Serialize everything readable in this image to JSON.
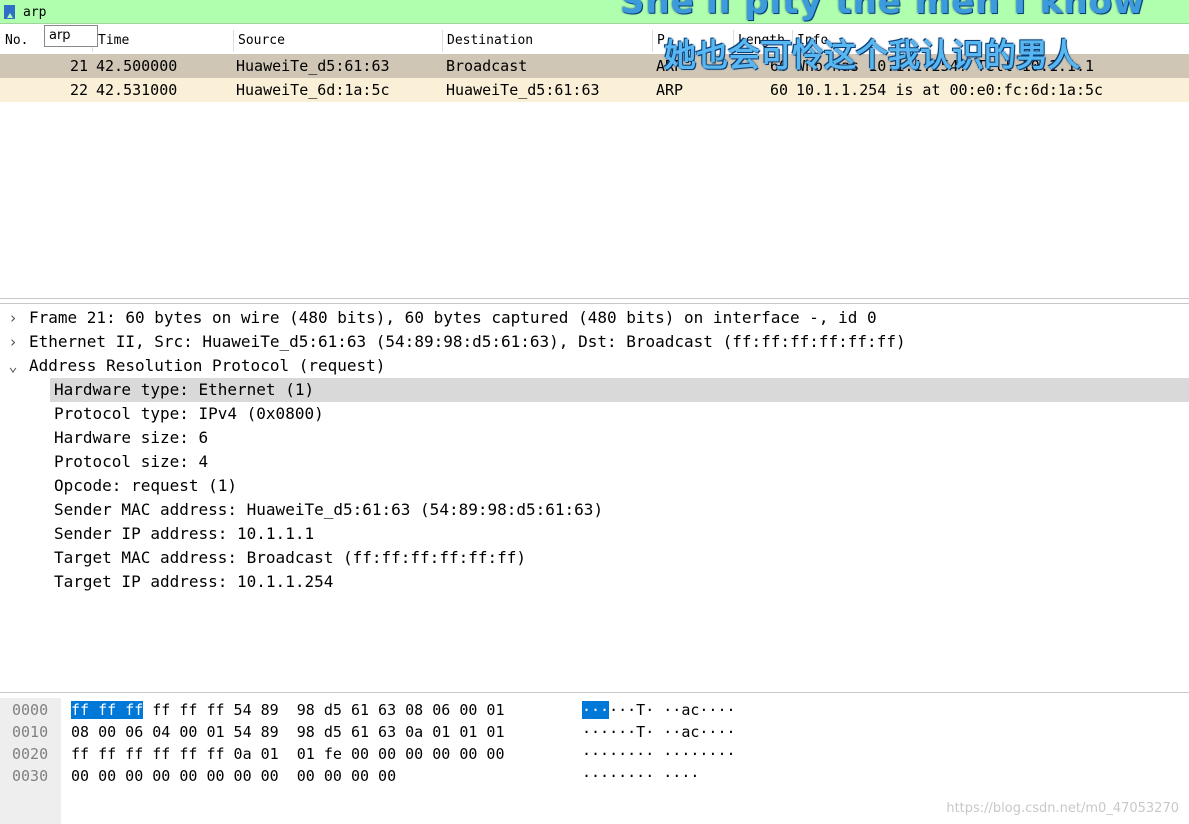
{
  "filter": {
    "value": "arp",
    "suggestion": "arp"
  },
  "packet_list": {
    "columns": [
      "No.",
      "Time",
      "Source",
      "Destination",
      "P",
      "Length",
      "Info"
    ],
    "rows": [
      {
        "no": "21",
        "time": "42.500000",
        "source": "HuaweiTe_d5:61:63",
        "destination": "Broadcast",
        "protocol": "ARP",
        "length": "60",
        "info": "Who has 10.1.1.254? Tell 10.1.1.1"
      },
      {
        "no": "22",
        "time": "42.531000",
        "source": "HuaweiTe_6d:1a:5c",
        "destination": "HuaweiTe_d5:61:63",
        "protocol": "ARP",
        "length": "60",
        "info": "10.1.1.254 is at 00:e0:fc:6d:1a:5c"
      }
    ]
  },
  "details": {
    "frame": "Frame 21: 60 bytes on wire (480 bits), 60 bytes captured (480 bits) on interface -, id 0",
    "ethernet": "Ethernet II, Src: HuaweiTe_d5:61:63 (54:89:98:d5:61:63), Dst: Broadcast (ff:ff:ff:ff:ff:ff)",
    "arp": "Address Resolution Protocol (request)",
    "arp_fields": [
      "Hardware type: Ethernet (1)",
      "Protocol type: IPv4 (0x0800)",
      "Hardware size: 6",
      "Protocol size: 4",
      "Opcode: request (1)",
      "Sender MAC address: HuaweiTe_d5:61:63 (54:89:98:d5:61:63)",
      "Sender IP address: 10.1.1.1",
      "Target MAC address: Broadcast (ff:ff:ff:ff:ff:ff)",
      "Target IP address: 10.1.1.254"
    ]
  },
  "bytes": {
    "rows": [
      {
        "offset": "0000",
        "hex_sel": "ff ff ff",
        "hex_rest": " ff ff ff 54 89  98 d5 61 63 08 06 00 01",
        "ascii_sel": "···",
        "ascii_rest": "···T· ··ac····"
      },
      {
        "offset": "0010",
        "hex_sel": "",
        "hex_rest": "08 00 06 04 00 01 54 89  98 d5 61 63 0a 01 01 01",
        "ascii_sel": "",
        "ascii_rest": "······T· ··ac····"
      },
      {
        "offset": "0020",
        "hex_sel": "",
        "hex_rest": "ff ff ff ff ff ff 0a 01  01 fe 00 00 00 00 00 00",
        "ascii_sel": "",
        "ascii_rest": "········ ········"
      },
      {
        "offset": "0030",
        "hex_sel": "",
        "hex_rest": "00 00 00 00 00 00 00 00  00 00 00 00",
        "ascii_sel": "",
        "ascii_rest": "········ ····"
      }
    ]
  },
  "overlay": {
    "lyric_en": "She'll pity the men I know",
    "lyric_zh": "她也会可怜这个我认识的男人",
    "watermark": "https://blog.csdn.net/m0_47053270"
  }
}
